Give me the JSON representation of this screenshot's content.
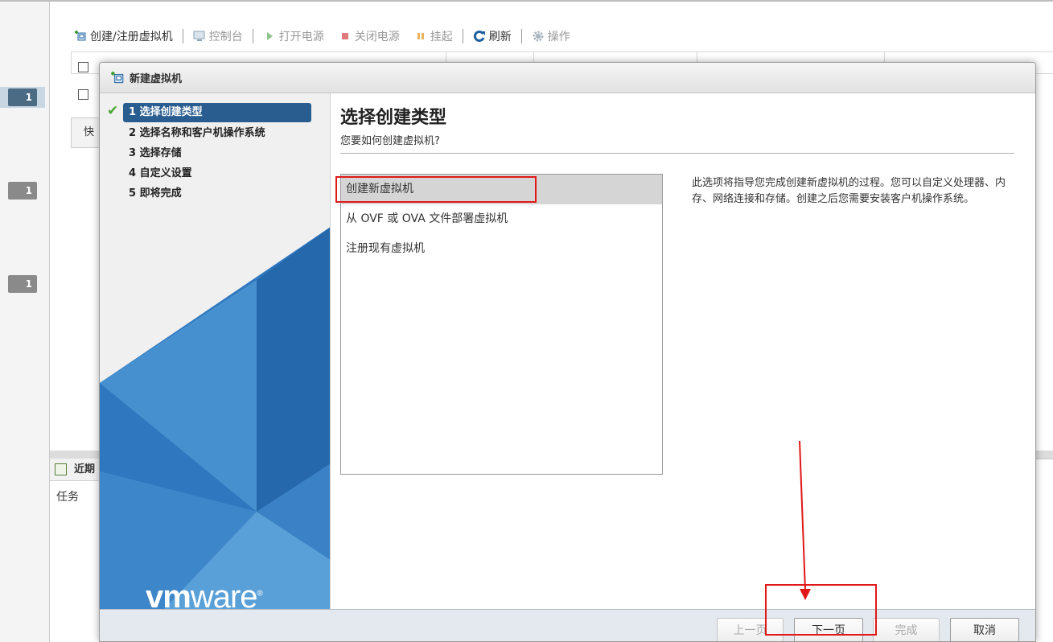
{
  "toolbar": {
    "create_register": "创建/注册虚拟机",
    "console": "控制台",
    "power_on": "打开电源",
    "power_off": "关闭电源",
    "suspend": "挂起",
    "refresh": "刷新",
    "actions": "操作"
  },
  "background": {
    "quick_label": "快",
    "badge_1": "1",
    "badge_2": "1",
    "badge_3": "1",
    "recent_tasks": "近期",
    "tasks_col": "任务"
  },
  "modal": {
    "title": "新建虚拟机",
    "steps": [
      {
        "label": "1 选择创建类型",
        "done": true
      },
      {
        "label": "2 选择名称和客户机操作系统"
      },
      {
        "label": "3 选择存储"
      },
      {
        "label": "4 自定义设置"
      },
      {
        "label": "5 即将完成"
      }
    ],
    "heading": "选择创建类型",
    "subheading": "您要如何创建虚拟机?",
    "options": [
      "创建新虚拟机",
      "从 OVF 或 OVA 文件部署虚拟机",
      "注册现有虚拟机"
    ],
    "description": "此选项将指导您完成创建新虚拟机的过程。您可以自定义处理器、内存、网络连接和存储。创建之后您需要安装客户机操作系统。",
    "logo": "vmware",
    "buttons": {
      "back": "上一页",
      "next": "下一页",
      "finish": "完成",
      "cancel": "取消"
    }
  },
  "colors": {
    "active_step": "#2a5d8f",
    "check": "#4ba333",
    "annotation": "#e01818",
    "selected_option": "#d5d5d5"
  }
}
